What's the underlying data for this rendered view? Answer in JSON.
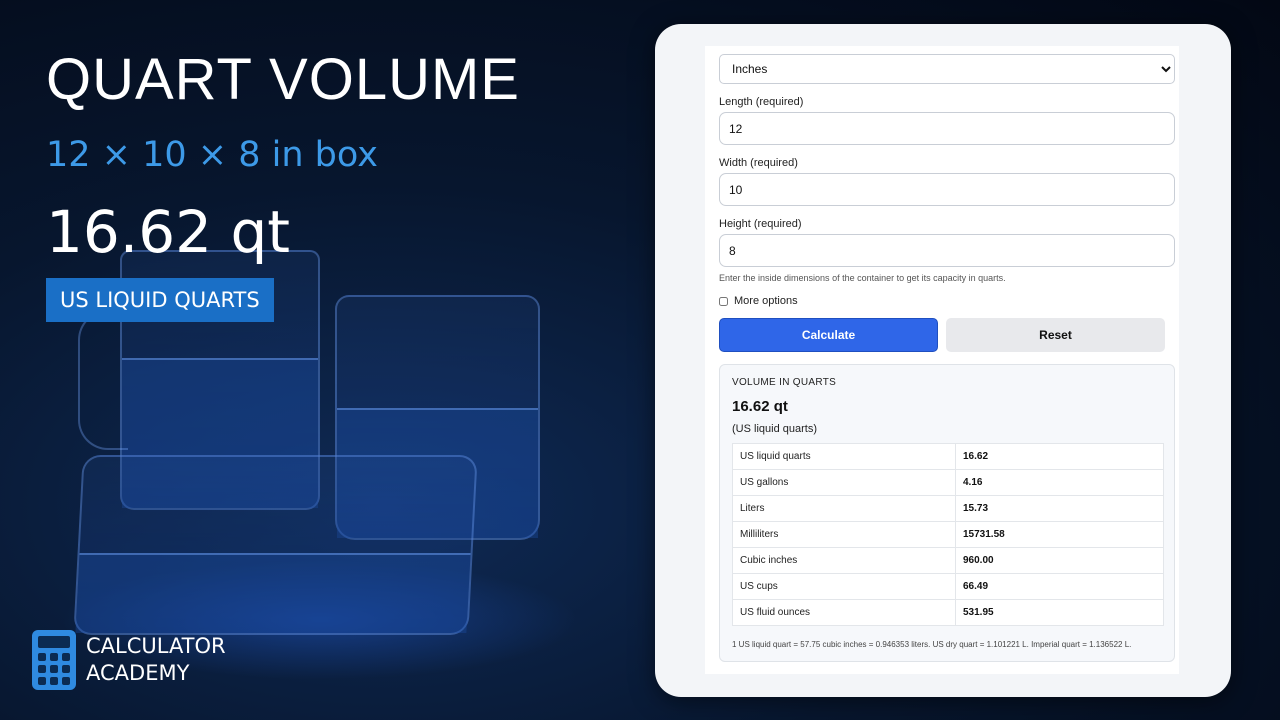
{
  "hero": {
    "title": "QUART VOLUME",
    "subtitle": "12 × 10 × 8 in box",
    "result": "16.62 qt",
    "badge": "US LIQUID QUARTS"
  },
  "brand": {
    "line1": "CALCULATOR",
    "line2": "ACADEMY",
    "icon": "calculator-icon"
  },
  "form": {
    "units_selected": "Inches",
    "length_label": "Length (required)",
    "length_value": "12",
    "width_label": "Width (required)",
    "width_value": "10",
    "height_label": "Height (required)",
    "height_value": "8",
    "hint": "Enter the inside dimensions of the container to get its capacity in quarts.",
    "more_options": "More options",
    "calculate": "Calculate",
    "reset": "Reset"
  },
  "result": {
    "heading": "VOLUME IN QUARTS",
    "value": "16.62 qt",
    "unit": "(US liquid quarts)",
    "rows": [
      {
        "label": "US liquid quarts",
        "value": "16.62"
      },
      {
        "label": "US gallons",
        "value": "4.16"
      },
      {
        "label": "Liters",
        "value": "15.73"
      },
      {
        "label": "Milliliters",
        "value": "15731.58"
      },
      {
        "label": "Cubic inches",
        "value": "960.00"
      },
      {
        "label": "US cups",
        "value": "66.49"
      },
      {
        "label": "US fluid ounces",
        "value": "531.95"
      }
    ],
    "footnote": "1 US liquid quart = 57.75 cubic inches = 0.946353 liters. US dry quart = 1.101221 L. Imperial quart = 1.136522 L."
  },
  "colors": {
    "accent": "#3d9ae8",
    "badge": "#1a6fc6",
    "calculate": "#2f66e8"
  }
}
